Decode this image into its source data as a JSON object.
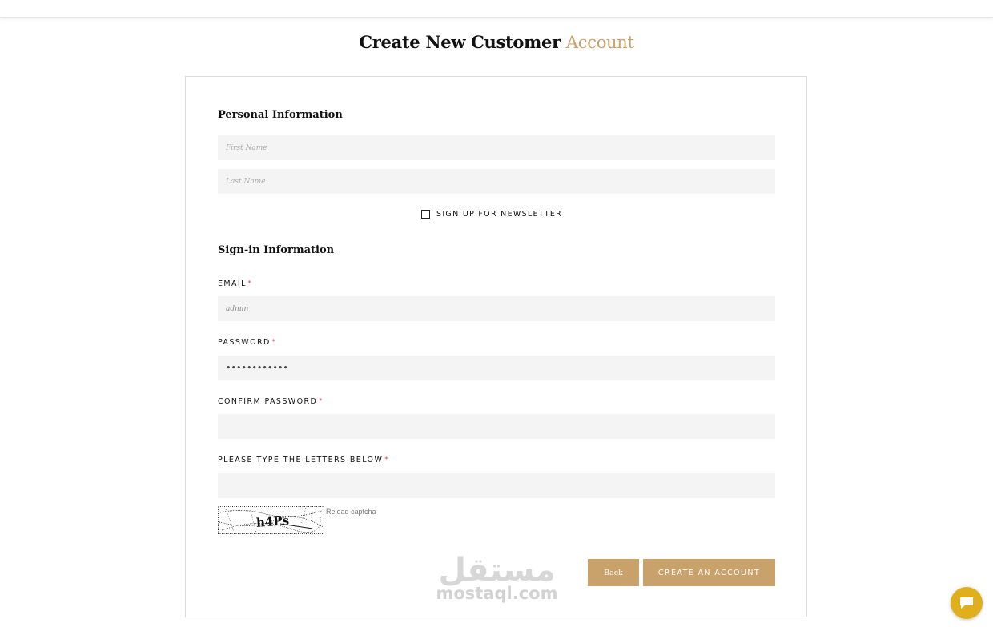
{
  "page": {
    "title_main": "Create New Customer",
    "title_accent": "Account"
  },
  "personal": {
    "heading": "Personal Information",
    "first_name_placeholder": "First Name",
    "last_name_placeholder": "Last Name",
    "newsletter_label": "SIGN UP FOR NEWSLETTER",
    "newsletter_checked": false
  },
  "signin": {
    "heading": "Sign-in Information",
    "email_label": "EMAIL",
    "email_value": "admin",
    "password_label": "PASSWORD",
    "password_value": "••••••••••••",
    "confirm_label": "CONFIRM PASSWORD",
    "confirm_value": "",
    "captcha_label": "PLEASE TYPE THE LETTERS BELOW",
    "captcha_value": "",
    "captcha_text": "h4Ps",
    "required_mark": "*",
    "reload_label": "Reload captcha"
  },
  "actions": {
    "back_label": "Back",
    "create_label": "CREATE AN ACCOUNT"
  },
  "watermark": {
    "arabic": "مستقل",
    "latin": "mostaql.com"
  },
  "colors": {
    "accent": "#c9a26b",
    "chat": "#e0b01c",
    "field_bg": "#f4f4f5",
    "required": "#d33"
  },
  "icons": {
    "chat": "chat-bubble-icon",
    "checkbox": "checkbox-icon"
  }
}
